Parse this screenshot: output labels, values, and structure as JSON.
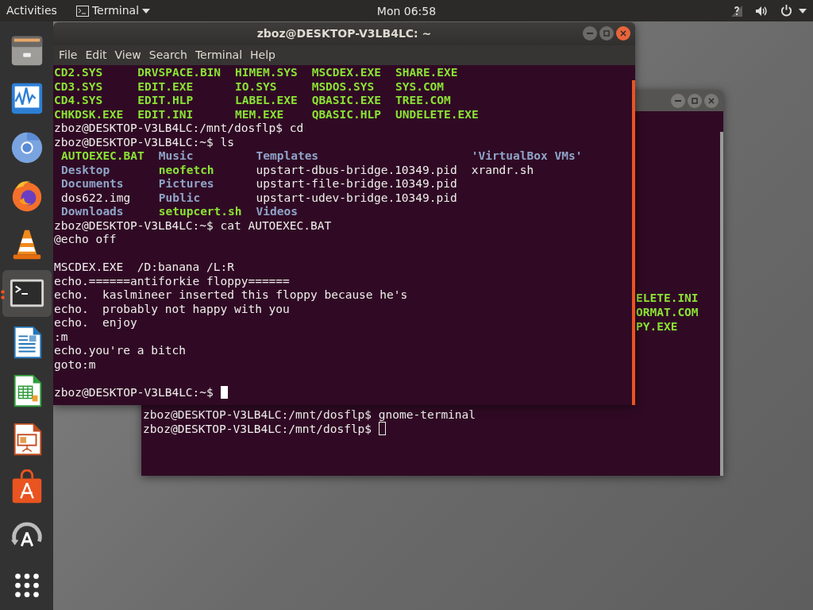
{
  "top_bar": {
    "activities": "Activities",
    "app_menu": "Terminal",
    "clock": "Mon 06:58"
  },
  "dock": {
    "items": [
      {
        "kind": "files",
        "selected": false,
        "running": false
      },
      {
        "kind": "monitor",
        "selected": false,
        "running": false
      },
      {
        "kind": "chromium",
        "selected": false,
        "running": false
      },
      {
        "kind": "firefox",
        "selected": false,
        "running": false
      },
      {
        "kind": "vlc",
        "selected": false,
        "running": false
      },
      {
        "kind": "terminal",
        "selected": true,
        "running": true
      },
      {
        "kind": "writer",
        "selected": false,
        "running": false
      },
      {
        "kind": "calc",
        "selected": false,
        "running": false
      },
      {
        "kind": "impress",
        "selected": false,
        "running": false
      },
      {
        "kind": "software",
        "selected": false,
        "running": false
      },
      {
        "kind": "updater",
        "selected": false,
        "running": false
      },
      {
        "kind": "apps",
        "selected": false,
        "running": false
      }
    ]
  },
  "back_terminal": {
    "focused": false,
    "fragments": [
      {
        "text": "ELETE.INI",
        "kind": "exec"
      },
      {
        "text": "ORMAT.COM",
        "kind": "exec"
      },
      {
        "text": "PY.EXE",
        "kind": "exec"
      }
    ],
    "lines": [
      {
        "kind": "text",
        "text": "zboz@DESKTOP-V3LB4LC:/mnt/dosflp$ gnome-terminal"
      },
      {
        "kind": "prompt",
        "text": "zboz@DESKTOP-V3LB4LC:/mnt/dosflp$"
      }
    ]
  },
  "front_terminal": {
    "focused": true,
    "title": "zboz@DESKTOP-V3LB4LC: ~",
    "menu": [
      "File",
      "Edit",
      "View",
      "Search",
      "Terminal",
      "Help"
    ],
    "lines": [
      {
        "kind": "grid",
        "indent": false,
        "rows": [
          [
            {
              "text": "CD2.SYS",
              "kind": "exec"
            },
            {
              "text": "DRVSPACE.BIN",
              "kind": "exec"
            },
            {
              "text": "HIMEM.SYS",
              "kind": "exec"
            },
            {
              "text": "MSCDEX.EXE",
              "kind": "exec"
            },
            {
              "text": "SHARE.EXE",
              "kind": "exec"
            }
          ],
          [
            {
              "text": "CD3.SYS",
              "kind": "exec"
            },
            {
              "text": "EDIT.EXE",
              "kind": "exec"
            },
            {
              "text": "IO.SYS",
              "kind": "exec"
            },
            {
              "text": "MSDOS.SYS",
              "kind": "exec"
            },
            {
              "text": "SYS.COM",
              "kind": "exec"
            }
          ],
          [
            {
              "text": "CD4.SYS",
              "kind": "exec"
            },
            {
              "text": "EDIT.HLP",
              "kind": "exec"
            },
            {
              "text": "LABEL.EXE",
              "kind": "exec"
            },
            {
              "text": "QBASIC.EXE",
              "kind": "exec"
            },
            {
              "text": "TREE.COM",
              "kind": "exec"
            }
          ],
          [
            {
              "text": "CHKDSK.EXE",
              "kind": "exec"
            },
            {
              "text": "EDIT.INI",
              "kind": "exec"
            },
            {
              "text": "MEM.EXE",
              "kind": "exec"
            },
            {
              "text": "QBASIC.HLP",
              "kind": "exec"
            },
            {
              "text": "UNDELETE.EXE",
              "kind": "exec"
            }
          ]
        ]
      },
      {
        "kind": "text",
        "text": "zboz@DESKTOP-V3LB4LC:/mnt/dosflp$ cd"
      },
      {
        "kind": "text",
        "text": "zboz@DESKTOP-V3LB4LC:~$ ls"
      },
      {
        "kind": "grid",
        "indent": true,
        "rows": [
          [
            {
              "text": "AUTOEXEC.BAT",
              "kind": "exec"
            },
            {
              "text": "Music",
              "kind": "dir"
            },
            {
              "text": "Templates",
              "kind": "dir"
            },
            {
              "text": "'VirtualBox VMs'",
              "kind": "dir"
            }
          ],
          [
            {
              "text": "Desktop",
              "kind": "dir"
            },
            {
              "text": "neofetch",
              "kind": "exec"
            },
            {
              "text": "upstart-dbus-bridge.10349.pid",
              "kind": "file"
            },
            {
              "text": "xrandr.sh",
              "kind": "file"
            }
          ],
          [
            {
              "text": "Documents",
              "kind": "dir"
            },
            {
              "text": "Pictures",
              "kind": "dir"
            },
            {
              "text": "upstart-file-bridge.10349.pid",
              "kind": "file"
            }
          ],
          [
            {
              "text": "dos622.img",
              "kind": "file"
            },
            {
              "text": "Public",
              "kind": "dir"
            },
            {
              "text": "upstart-udev-bridge.10349.pid",
              "kind": "file"
            }
          ],
          [
            {
              "text": "Downloads",
              "kind": "dir"
            },
            {
              "text": "setupcert.sh",
              "kind": "exec"
            },
            {
              "text": "Videos",
              "kind": "dir"
            }
          ]
        ]
      },
      {
        "kind": "text",
        "text": "zboz@DESKTOP-V3LB4LC:~$ cat AUTOEXEC.BAT"
      },
      {
        "kind": "text",
        "text": "@echo off"
      },
      {
        "kind": "blank"
      },
      {
        "kind": "text",
        "text": "MSCDEX.EXE  /D:banana /L:R"
      },
      {
        "kind": "text",
        "text": "echo.======antiforkie floppy======"
      },
      {
        "kind": "text",
        "text": "echo.  kaslmineer inserted this floppy because he's"
      },
      {
        "kind": "text",
        "text": "echo.  probably not happy with you"
      },
      {
        "kind": "text",
        "text": "echo.  enjoy"
      },
      {
        "kind": "text",
        "text": ":m"
      },
      {
        "kind": "text",
        "text": "echo.you're a bitch"
      },
      {
        "kind": "text",
        "text": "goto:m"
      },
      {
        "kind": "blank"
      },
      {
        "kind": "prompt",
        "text": "zboz@DESKTOP-V3LB4LC:~$"
      }
    ]
  }
}
